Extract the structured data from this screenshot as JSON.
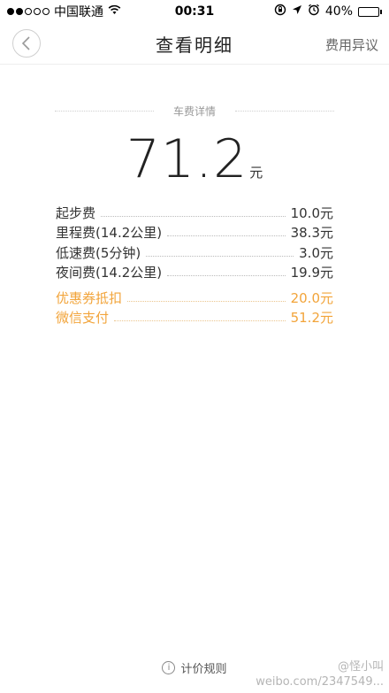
{
  "status_bar": {
    "carrier": "中国联通",
    "time": "00:31",
    "battery": "40%",
    "battery_level": 0.4
  },
  "nav": {
    "title": "查看明细",
    "action": "费用异议"
  },
  "section": {
    "title": "车费详情"
  },
  "total": {
    "amount": "71.2",
    "unit": "元"
  },
  "fees": [
    {
      "label": "起步费",
      "value": "10.0元"
    },
    {
      "label": "里程费(14.2公里)",
      "value": "38.3元"
    },
    {
      "label": "低速费(5分钟)",
      "value": "3.0元"
    },
    {
      "label": "夜间费(14.2公里)",
      "value": "19.9元"
    }
  ],
  "payments": [
    {
      "label": "优惠券抵扣",
      "value": "20.0元"
    },
    {
      "label": "微信支付",
      "value": "51.2元"
    }
  ],
  "footer": {
    "rules_label": "计价规则"
  },
  "watermark": {
    "handle": "@怪小叫",
    "url": "weibo.com/2347549..."
  },
  "colors": {
    "highlight": "#f2a43a"
  }
}
